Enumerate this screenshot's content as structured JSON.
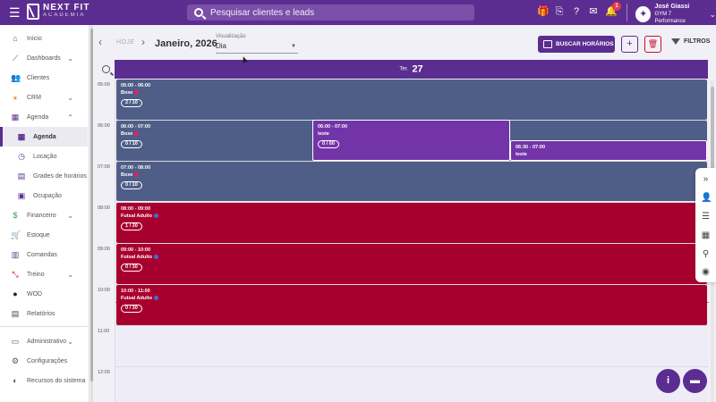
{
  "brand": {
    "name": "NEXT FIT",
    "sub": "ACADEMIA"
  },
  "search": {
    "placeholder": "Pesquisar clientes e leads"
  },
  "notifications": {
    "count": "1"
  },
  "user": {
    "name": "José Giassi",
    "gym": "GYM 7 Performance"
  },
  "sidebar": {
    "items": [
      {
        "label": "Início"
      },
      {
        "label": "Dashboards"
      },
      {
        "label": "Clientes"
      },
      {
        "label": "CRM"
      },
      {
        "label": "Agenda"
      },
      {
        "label": "Agenda"
      },
      {
        "label": "Locação"
      },
      {
        "label": "Grades de horários"
      },
      {
        "label": "Ocupação"
      },
      {
        "label": "Financeiro"
      },
      {
        "label": "Estoque"
      },
      {
        "label": "Comandas"
      },
      {
        "label": "Treino"
      },
      {
        "label": "WOD"
      },
      {
        "label": "Relatórios"
      },
      {
        "label": "Administrativo"
      },
      {
        "label": "Configurações"
      },
      {
        "label": "Recursos do sistema"
      }
    ]
  },
  "toolbar": {
    "today": "HOJE",
    "date_title": "Janeiro, 2026",
    "view_label": "Visualização",
    "view_value": "Dia",
    "buscar_label": "BUSCAR HORÁRIOS",
    "add_label": "+",
    "filter_label": "FILTROS"
  },
  "day": {
    "name": "Ter.",
    "number": "27"
  },
  "times": [
    "05:00",
    "06:00",
    "07:00",
    "08:00",
    "09:00",
    "10:00",
    "11:00",
    "12:00"
  ],
  "events": [
    {
      "time": "05:00 - 06:00",
      "title": "Boxe",
      "count": "2 / 10"
    },
    {
      "time": "06:00 - 07:00",
      "title": "Boxe",
      "count": "0 / 10"
    },
    {
      "time": "06:00 - 07:00",
      "title": "teste",
      "count": "0 / 00"
    },
    {
      "time": "06:30 - 07:00",
      "title": "teste",
      "count": ""
    },
    {
      "time": "07:00 - 08:00",
      "title": "Boxe",
      "count": "0 / 10"
    },
    {
      "time": "08:00 - 09:00",
      "title": "Futsal Adulto",
      "count": "1 / 30"
    },
    {
      "time": "09:00 - 10:00",
      "title": "Futsal Adulto",
      "count": "0 / 30"
    },
    {
      "time": "10:00 - 11:00",
      "title": "Futsal Adulto",
      "count": "0 / 30"
    }
  ],
  "colors": {
    "brand": "#5c2d91",
    "event_gray": "#4e5e86",
    "event_purple": "#7334a8",
    "event_red": "#a8002e"
  }
}
